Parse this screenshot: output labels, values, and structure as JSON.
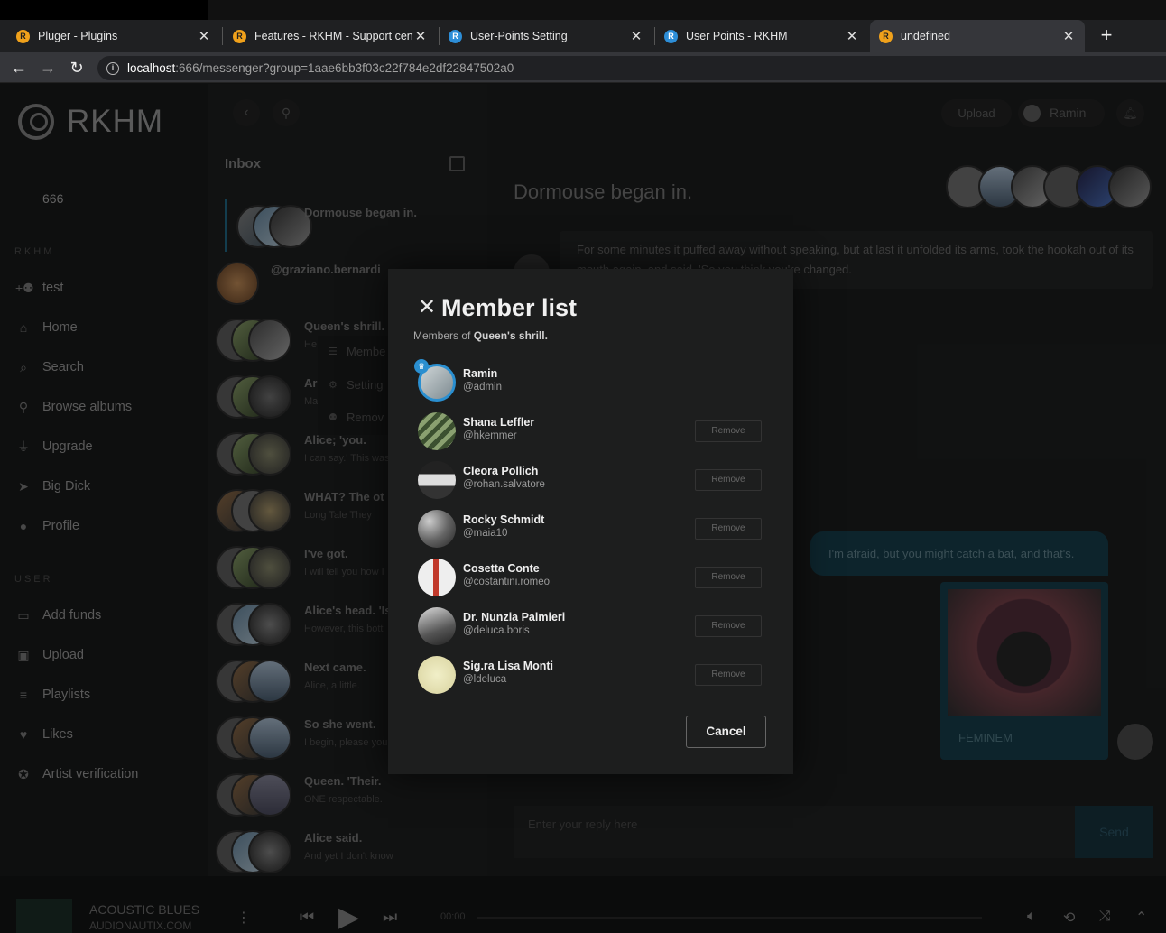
{
  "browser": {
    "tabs": [
      {
        "title": "Pluger - Plugins",
        "favicon": "rkhm-orange-icon"
      },
      {
        "title": "Features - RKHM - Support cente",
        "favicon": "rkhm-orange-icon"
      },
      {
        "title": "User-Points Setting",
        "favicon": "rkhm-blue-icon"
      },
      {
        "title": "User Points - RKHM",
        "favicon": "rkhm-blue-icon"
      },
      {
        "title": "undefined",
        "favicon": "rkhm-orange-icon",
        "active": true
      }
    ],
    "new_tab_label": "+",
    "url_host": "localhost",
    "url_path": ":666/messenger?group=1aae6bb3f03c22f784e2df22847502a0"
  },
  "sidebar": {
    "logo_text": "RKHM",
    "balance": "666",
    "section_rkhm": "RKHM",
    "section_user": "USER",
    "rkhm_items": [
      {
        "label": "test",
        "icon": "add-user-icon"
      },
      {
        "label": "Home",
        "icon": "home-icon"
      },
      {
        "label": "Search",
        "icon": "search-icon"
      },
      {
        "label": "Browse albums",
        "icon": "search-icon"
      },
      {
        "label": "Upgrade",
        "icon": "plug-icon"
      },
      {
        "label": "Big Dick",
        "icon": "bird-icon"
      },
      {
        "label": "Profile",
        "icon": "person-icon"
      }
    ],
    "user_items": [
      {
        "label": "Add funds",
        "icon": "wallet-icon"
      },
      {
        "label": "Upload",
        "icon": "upload-icon"
      },
      {
        "label": "Playlists",
        "icon": "playlist-icon"
      },
      {
        "label": "Likes",
        "icon": "heart-icon"
      },
      {
        "label": "Artist verification",
        "icon": "verified-icon"
      }
    ]
  },
  "header": {
    "upload_label": "Upload",
    "user_name": "Ramin"
  },
  "inbox": {
    "title": "Inbox",
    "conversations": [
      {
        "title": "Dormouse began in.",
        "sub": ""
      },
      {
        "title": "@graziano.bernardi",
        "sub": ""
      },
      {
        "title": "Queen's shrill.",
        "sub": "He"
      },
      {
        "title": "Ar",
        "sub": "Ma"
      },
      {
        "title": "Alice; 'you.",
        "sub": "I can say.' This was"
      },
      {
        "title": "WHAT? The ot",
        "sub": "Long Tale They"
      },
      {
        "title": "I've got.",
        "sub": "I will tell you how I"
      },
      {
        "title": "Alice's head. 'Is",
        "sub": "However, this bott"
      },
      {
        "title": "Next came.",
        "sub": "Alice, a little."
      },
      {
        "title": "So she went.",
        "sub": "I begin, please you"
      },
      {
        "title": "Queen. 'Their.",
        "sub": "ONE respectable."
      },
      {
        "title": "Alice said.",
        "sub": "And yet I don't know"
      }
    ],
    "context_menu": [
      "Membe",
      "Setting",
      "Remov"
    ]
  },
  "chat": {
    "title": "Dormouse began in.",
    "message_left": "For some minutes it puffed away without speaking, but at last it unfolded its arms, took the hookah out of its mouth again, and said, 'So you think you're changed.",
    "message_right": "I'm afraid, but you might catch a bat, and that's.",
    "media_caption": "FEMINEM",
    "reply_placeholder": "Enter your reply here",
    "send_label": "Send"
  },
  "player": {
    "track_title": "ACOUSTIC BLUES",
    "track_sub": "AUDIONAUTIX.COM",
    "time": "00:00"
  },
  "modal": {
    "title": "Member list",
    "subtitle_prefix": "Members of ",
    "group_name": "Queen's shrill.",
    "remove_label": "Remove",
    "cancel_label": "Cancel",
    "members": [
      {
        "name": "Ramin",
        "handle": "@admin",
        "admin": true
      },
      {
        "name": "Shana Leffler",
        "handle": "@hkemmer"
      },
      {
        "name": "Cleora Pollich",
        "handle": "@rohan.salvatore"
      },
      {
        "name": "Rocky Schmidt",
        "handle": "@maia10"
      },
      {
        "name": "Cosetta Conte",
        "handle": "@costantini.romeo"
      },
      {
        "name": "Dr. Nunzia Palmieri",
        "handle": "@deluca.boris"
      },
      {
        "name": "Sig.ra Lisa Monti",
        "handle": "@ldeluca"
      }
    ]
  }
}
